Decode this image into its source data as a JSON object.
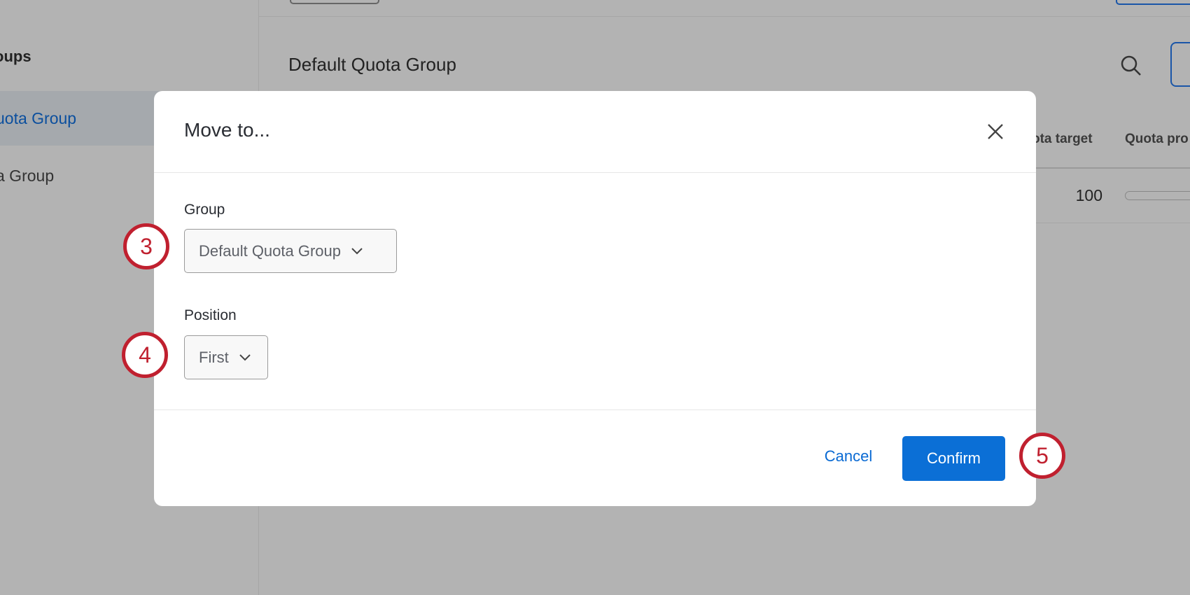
{
  "background": {
    "sidebar_title": "oups",
    "sidebar_items": [
      "uota Group",
      "a Group"
    ],
    "main_title": "Default Quota Group",
    "table_headers": [
      "ota target",
      "Quota pro"
    ],
    "table_row": {
      "quota_target": "100"
    }
  },
  "modal": {
    "title": "Move to...",
    "group_label": "Group",
    "group_value": "Default Quota Group",
    "position_label": "Position",
    "position_value": "First",
    "cancel_label": "Cancel",
    "confirm_label": "Confirm"
  },
  "annotations": [
    "3",
    "4",
    "5"
  ],
  "colors": {
    "accent": "#0b6fd6",
    "annotation": "#c0202f"
  }
}
